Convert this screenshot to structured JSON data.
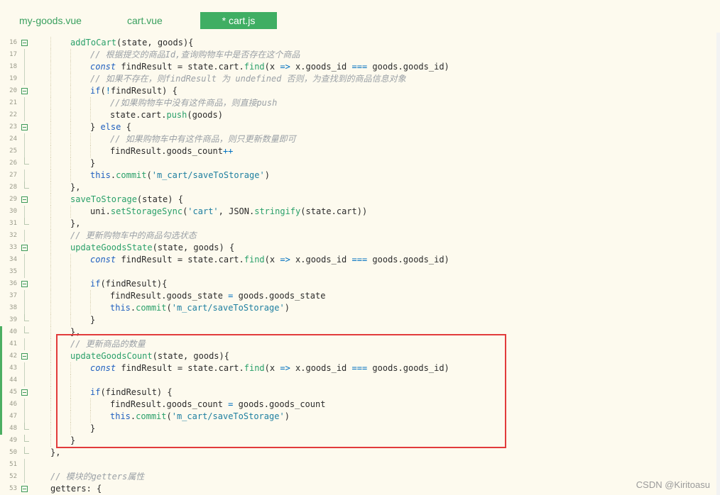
{
  "tabs": [
    {
      "label": "my-goods.vue",
      "active": false
    },
    {
      "label": "cart.vue",
      "active": false
    },
    {
      "label": "* cart.js",
      "active": true
    }
  ],
  "colors": {
    "background": "#fdfaee",
    "accent_green": "#3fae63",
    "highlight_red": "#e23b3b"
  },
  "editor": {
    "lines": [
      {
        "n": "16",
        "fold": "start",
        "indent": 1,
        "html": "<span class=\"f\">addToCart</span>(state, goods){"
      },
      {
        "n": "17",
        "fold": "line",
        "indent": 2,
        "html": "<span class=\"c\">// 根据提交的商品Id,查询购物车中是否存在这个商品</span>"
      },
      {
        "n": "18",
        "fold": "line",
        "indent": 2,
        "html": "<span class=\"k\"><i>const</i></span> findResult = state.cart.<span class=\"f\">find</span>(x <span class=\"o\">=&gt;</span> x.goods_id <span class=\"o\">===</span> goods.goods_id)"
      },
      {
        "n": "19",
        "fold": "line",
        "indent": 2,
        "html": "<span class=\"c\">// 如果不存在，则findResult 为 undefined 否则，为查找到的商品信息对象</span>"
      },
      {
        "n": "20",
        "fold": "start",
        "indent": 2,
        "html": "<span class=\"k\">if</span>(<span class=\"o\">!</span>findResult) {"
      },
      {
        "n": "21",
        "fold": "line",
        "indent": 3,
        "html": "<span class=\"c\">//如果购物车中没有这件商品，则直接push</span>"
      },
      {
        "n": "22",
        "fold": "line",
        "indent": 3,
        "html": "state.cart.<span class=\"f\">push</span>(goods)"
      },
      {
        "n": "23",
        "fold": "start",
        "indent": 2,
        "html": "} <span class=\"k\">else</span> {"
      },
      {
        "n": "24",
        "fold": "line",
        "indent": 3,
        "html": "<span class=\"c\">// 如果购物车中有这件商品，则只更新数量即可</span>"
      },
      {
        "n": "25",
        "fold": "line",
        "indent": 3,
        "html": "findResult.goods_count<span class=\"o\">++</span>"
      },
      {
        "n": "26",
        "fold": "end",
        "indent": 2,
        "html": "}"
      },
      {
        "n": "27",
        "fold": "line",
        "indent": 2,
        "html": "<span class=\"k\">this</span>.<span class=\"f\">commit</span>(<span class=\"s\">'m_cart/saveToStorage'</span>)"
      },
      {
        "n": "28",
        "fold": "end",
        "indent": 1,
        "html": "},"
      },
      {
        "n": "29",
        "fold": "start",
        "indent": 1,
        "html": "<span class=\"f\">saveToStorage</span>(state) {"
      },
      {
        "n": "30",
        "fold": "line",
        "indent": 2,
        "html": "uni.<span class=\"f\">setStorageSync</span>(<span class=\"s\">'cart'</span>, JSON.<span class=\"f\">stringify</span>(state.cart))"
      },
      {
        "n": "31",
        "fold": "end",
        "indent": 1,
        "html": "},"
      },
      {
        "n": "32",
        "fold": "line",
        "indent": 1,
        "html": "<span class=\"c\">// 更新购物车中的商品勾选状态</span>"
      },
      {
        "n": "33",
        "fold": "start",
        "indent": 1,
        "html": "<span class=\"f\">updateGoodsState</span>(state, goods) {"
      },
      {
        "n": "34",
        "fold": "line",
        "indent": 2,
        "html": "<span class=\"k\"><i>const</i></span> findResult = state.cart.<span class=\"f\">find</span>(x <span class=\"o\">=&gt;</span> x.goods_id <span class=\"o\">===</span> goods.goods_id)"
      },
      {
        "n": "35",
        "fold": "line",
        "indent": 2,
        "html": ""
      },
      {
        "n": "36",
        "fold": "start",
        "indent": 2,
        "html": "<span class=\"k\">if</span>(findResult){"
      },
      {
        "n": "37",
        "fold": "line",
        "indent": 3,
        "html": "findResult.goods_state <span class=\"o\">=</span> goods.goods_state"
      },
      {
        "n": "38",
        "fold": "line",
        "indent": 3,
        "html": "<span class=\"k\">this</span>.<span class=\"f\">commit</span>(<span class=\"s\">'m_cart/saveToStorage'</span>)"
      },
      {
        "n": "39",
        "fold": "end",
        "indent": 2,
        "html": "}"
      },
      {
        "n": "40",
        "fold": "end",
        "indent": 1,
        "html": "},"
      },
      {
        "n": "41",
        "fold": "line",
        "indent": 1,
        "html": "<span class=\"c\">// 更新商品的数量</span>"
      },
      {
        "n": "42",
        "fold": "start",
        "indent": 1,
        "html": "<span class=\"f\">updateGoodsCount</span>(state, goods){"
      },
      {
        "n": "43",
        "fold": "line",
        "indent": 2,
        "html": "<span class=\"k\"><i>const</i></span> findResult = state.cart.<span class=\"f\">find</span>(x <span class=\"o\">=&gt;</span> x.goods_id <span class=\"o\">===</span> goods.goods_id)"
      },
      {
        "n": "44",
        "fold": "line",
        "indent": 2,
        "html": ""
      },
      {
        "n": "45",
        "fold": "start",
        "indent": 2,
        "html": "<span class=\"k\">if</span>(findResult) {"
      },
      {
        "n": "46",
        "fold": "line",
        "indent": 3,
        "html": "findResult.goods_count <span class=\"o\">=</span> goods.goods_count"
      },
      {
        "n": "47",
        "fold": "line",
        "indent": 3,
        "html": "<span class=\"k\">this</span>.<span class=\"f\">commit</span>(<span class=\"s\">'m_cart/saveToStorage'</span>)"
      },
      {
        "n": "48",
        "fold": "end",
        "indent": 2,
        "html": "}"
      },
      {
        "n": "49",
        "fold": "end",
        "indent": 1,
        "html": "}"
      },
      {
        "n": "50",
        "fold": "end",
        "indent": 0,
        "html": "},"
      },
      {
        "n": "51",
        "fold": "line",
        "indent": 0,
        "html": ""
      },
      {
        "n": "52",
        "fold": "line",
        "indent": 0,
        "html": "<span class=\"c\">// 模块的getters属性</span>"
      },
      {
        "n": "53",
        "fold": "start",
        "indent": 0,
        "html": "getters: {"
      }
    ]
  },
  "watermark": "CSDN @Kiritoasu"
}
